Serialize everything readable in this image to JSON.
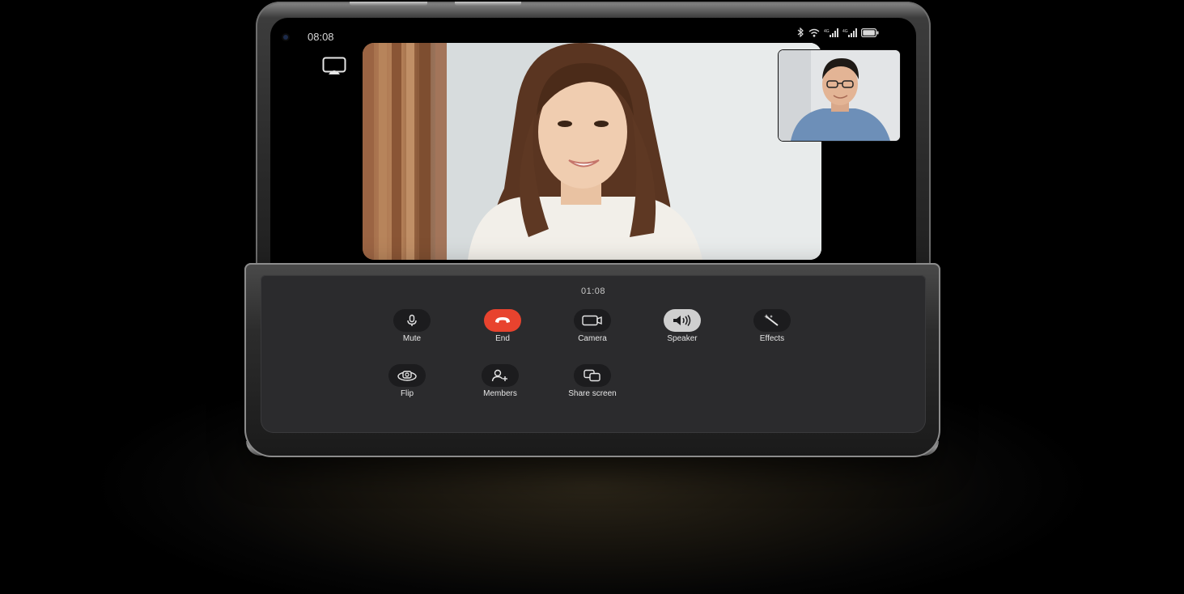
{
  "status_bar": {
    "time": "08:08",
    "icons": [
      "bluetooth-icon",
      "wifi-icon",
      "signal-4g-icon",
      "signal-4g-icon",
      "battery-icon"
    ]
  },
  "call": {
    "timer": "01:08"
  },
  "controls": {
    "mute": {
      "label": "Mute",
      "icon": "microphone-icon"
    },
    "end": {
      "label": "End",
      "icon": "hangup-icon",
      "color": "#e8432e"
    },
    "camera": {
      "label": "Camera",
      "icon": "video-camera-icon"
    },
    "speaker": {
      "label": "Speaker",
      "icon": "speaker-icon",
      "active": true
    },
    "effects": {
      "label": "Effects",
      "icon": "magic-wand-icon"
    },
    "flip": {
      "label": "Flip",
      "icon": "flip-camera-icon"
    },
    "members": {
      "label": "Members",
      "icon": "add-person-icon"
    },
    "share_screen": {
      "label": "Share screen",
      "icon": "share-screen-icon"
    }
  }
}
